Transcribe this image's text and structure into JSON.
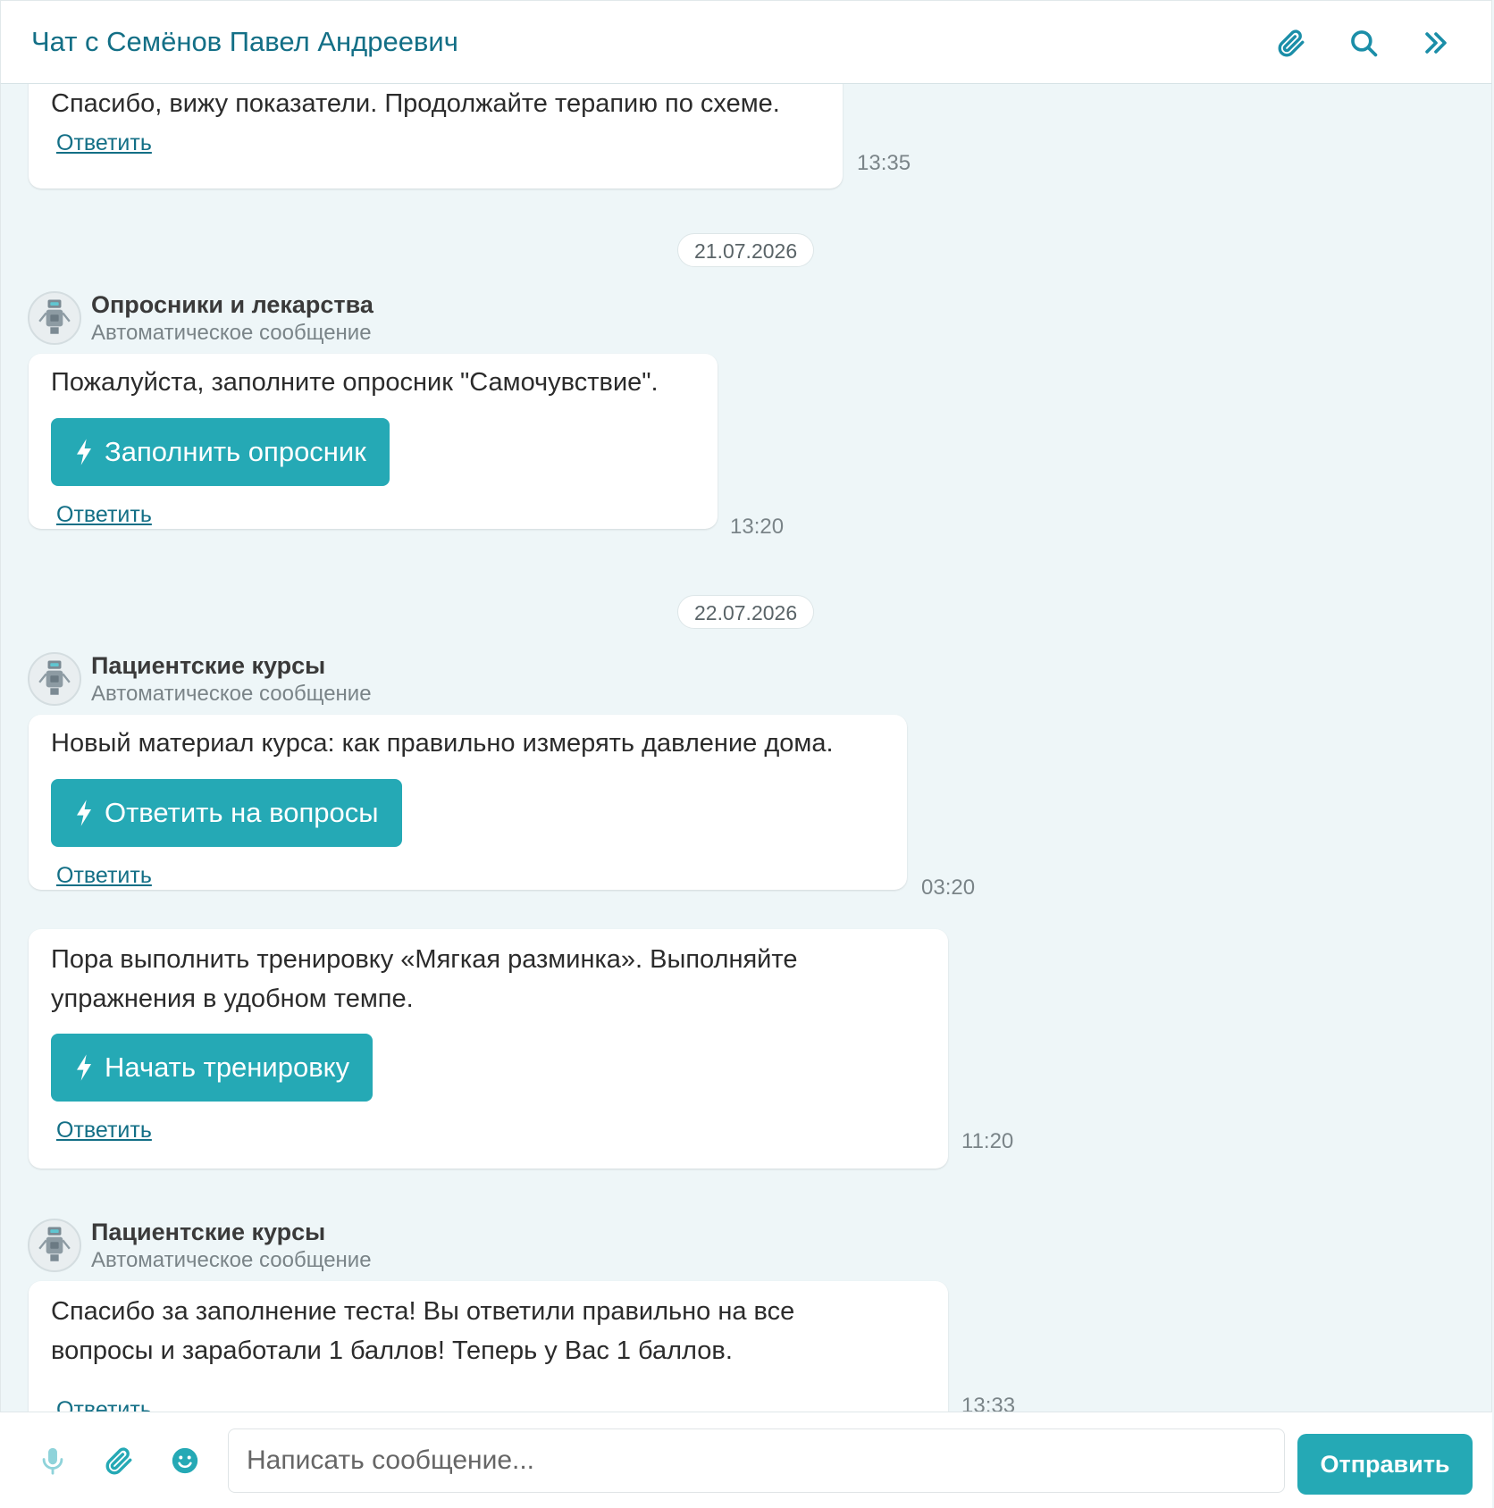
{
  "header": {
    "title": "Чат с Семёнов Павел Андреевич",
    "icons": [
      "paperclip-icon",
      "search-icon",
      "double-chevron-right-icon"
    ]
  },
  "colors": {
    "accent": "#25a9b5",
    "link": "#136f86",
    "background": "#eef6f8"
  },
  "reply_label": "Ответить",
  "messages": {
    "m0": {
      "text": "Спасибо, вижу показатели. Продолжайте терапию по схеме.",
      "time": "13:35"
    },
    "d1": "21.07.2026",
    "g1": {
      "sender": "Опросники и лекарства",
      "subtitle": "Автоматическое сообщение"
    },
    "m1": {
      "text": "Пожалуйста, заполните опросник \"Самочувствие\".",
      "button": "Заполнить опросник",
      "time": "13:20"
    },
    "d2": "22.07.2026",
    "g2": {
      "sender": "Пациентские курсы",
      "subtitle": "Автоматическое сообщение"
    },
    "m2": {
      "text": "Новый материал курса: как правильно измерять давление дома.",
      "button": "Ответить на вопросы",
      "time": "03:20"
    },
    "m3": {
      "line1": "Пора выполнить тренировку «Мягкая разминка». Выполняйте",
      "line2": "упражнения в удобном темпе.",
      "button": "Начать тренировку",
      "time": "11:20"
    },
    "g3": {
      "sender": "Пациентские курсы",
      "subtitle": "Автоматическое сообщение"
    },
    "m4": {
      "line1": "Спасибо за заполнение теста! Вы ответили правильно на все",
      "line2": "вопросы и заработали 1 баллов! Теперь у Вас 1 баллов.",
      "time": "13:33"
    }
  },
  "composer": {
    "placeholder": "Написать сообщение...",
    "send_label": "Отправить",
    "icons": [
      "microphone-icon",
      "paperclip-icon",
      "emoji-icon"
    ]
  }
}
